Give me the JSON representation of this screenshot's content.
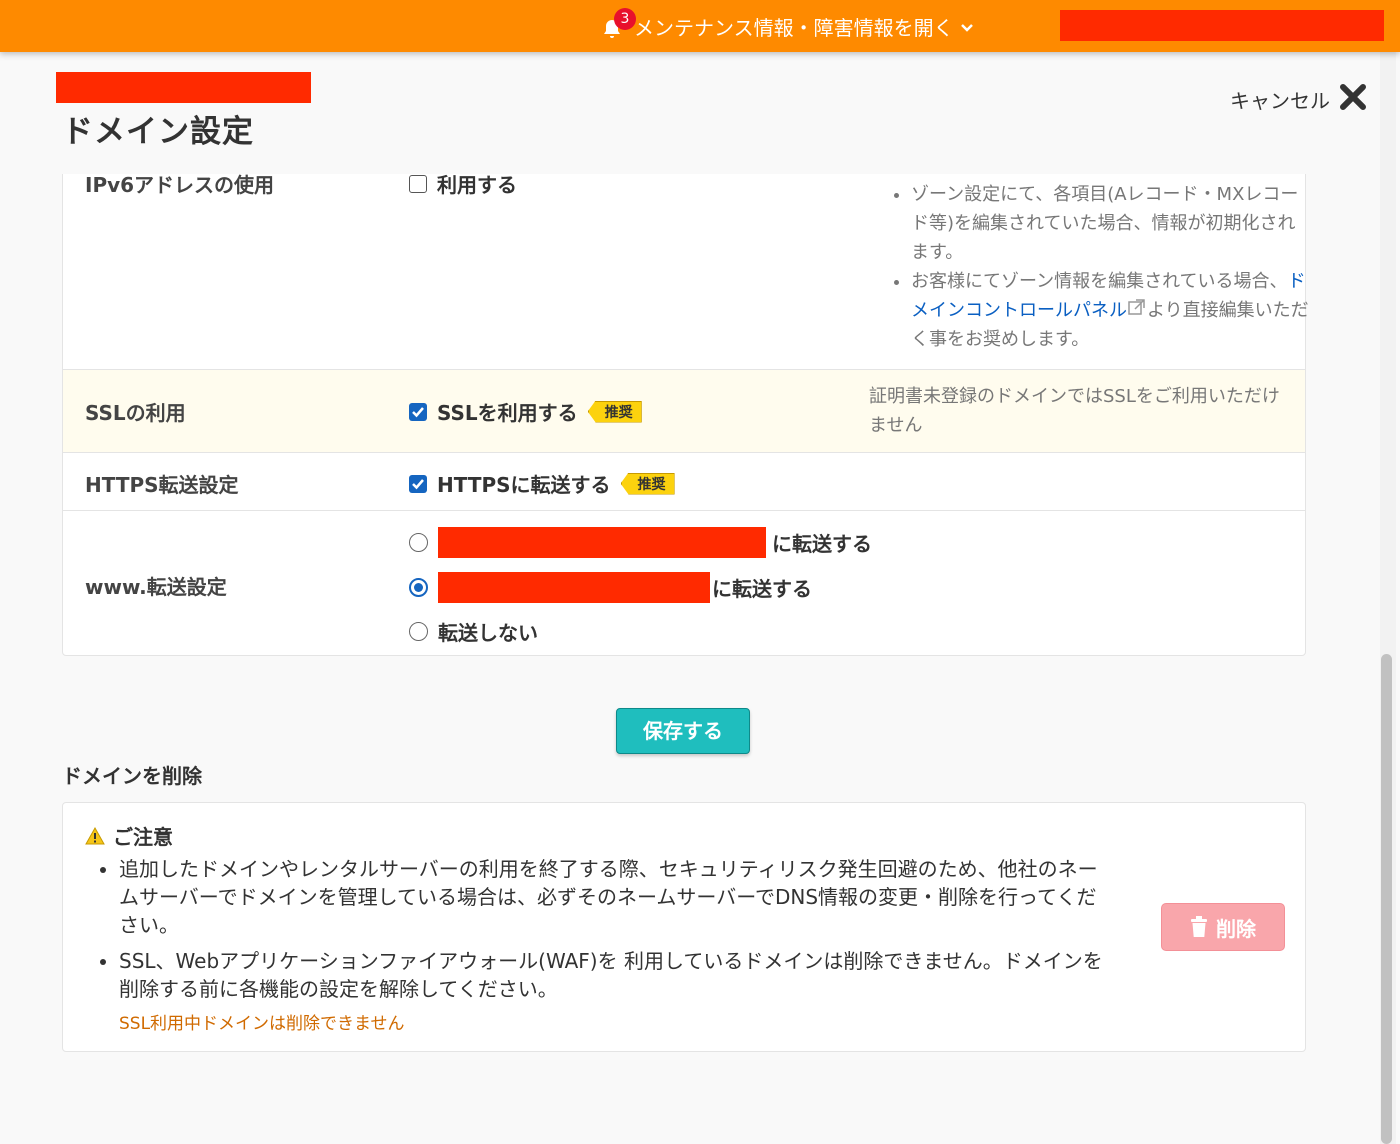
{
  "topbar": {
    "notification_count": "3",
    "notice_label": "メンテナンス情報・障害情報を開く",
    "color": "#fe8a00"
  },
  "page": {
    "title": "ドメイン設定",
    "cancel_label": "キャンセル"
  },
  "settings": {
    "ipv6": {
      "label": "IPv6アドレスの使用",
      "checkbox_label": "利用する",
      "checked": false,
      "notes": [
        "ゾーン設定にて、各項目(Aレコード・MXレコード等)を編集されていた場合、情報が初期化されます。",
        "お客様にてゾーン情報を編集されている場合、"
      ],
      "note_link": "ドメインコントロールパネル",
      "note_tail": "より直接編集いただく事をお奨めします。"
    },
    "ssl": {
      "label": "SSLの利用",
      "checkbox_label": "SSLを利用する",
      "checked": true,
      "tag": "推奨",
      "note": "証明書未登録のドメインではSSLをご利用いただけません"
    },
    "https": {
      "label": "HTTPS転送設定",
      "checkbox_label": "HTTPSに転送する",
      "checked": true,
      "tag": "推奨"
    },
    "www": {
      "label": "www.転送設定",
      "options": [
        {
          "suffix": "に転送する",
          "selected": false
        },
        {
          "suffix": "に転送する",
          "selected": true
        },
        {
          "label": "転送しない",
          "selected": false
        }
      ]
    }
  },
  "save_label": "保存する",
  "delete_section": {
    "heading": "ドメインを削除",
    "caution_title": "ご注意",
    "items": [
      "追加したドメインやレンタルサーバーの利用を終了する際、セキュリティリスク発生回避のため、他社のネームサーバーでドメインを管理している場合は、必ずそのネームサーバーでDNS情報の変更・削除を行ってください。",
      "SSL、Webアプリケーションファイアウォール(WAF)を 利用しているドメインは削除できません。ドメインを削除する前に各機能の設定を解除してください。"
    ],
    "warning": "SSL利用中ドメインは削除できません",
    "delete_label": "削除"
  }
}
